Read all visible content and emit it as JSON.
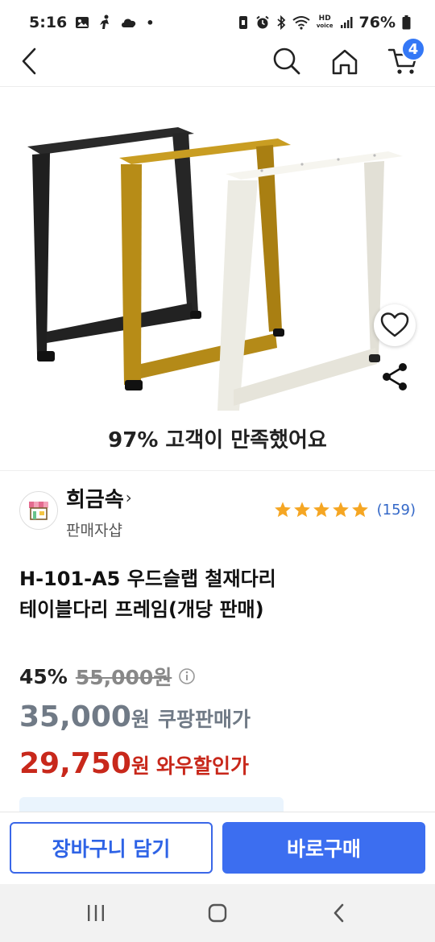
{
  "status_bar": {
    "time": "5:16",
    "dot": "•",
    "battery": "76%",
    "hd_label": "HD",
    "volte_label": "voice",
    "left_icons": [
      "gallery-icon",
      "figure-icon",
      "cloud-icon"
    ],
    "right_icons": [
      "vibrate-icon",
      "alarm-icon",
      "bluetooth-icon",
      "wifi-icon",
      "signal-icon",
      "battery-icon"
    ]
  },
  "header": {
    "icons": [
      "back-icon",
      "search-icon",
      "home-icon",
      "cart-icon"
    ],
    "cart_count": "4"
  },
  "product": {
    "satisfaction": "97% 고객이 만족했어요",
    "colors": {
      "black": "#252525",
      "gold": "#b8901b",
      "white": "#eeece4"
    },
    "image_icons": [
      "heart-icon",
      "share-icon"
    ]
  },
  "seller": {
    "name": "희금속",
    "type": "판매자샵",
    "rating": 5,
    "review_count": "(159)",
    "star_color": "#f5a623"
  },
  "title": {
    "line1": "H-101-A5 우드슬랩 철재다리",
    "line2": "테이블다리 프레임(개당 판매)"
  },
  "price": {
    "discount_rate": "45%",
    "original": "55,000원",
    "coupang_price": "35,000",
    "coupang_won": "원",
    "coupang_label": "쿠팡판매가",
    "wow_price": "29,750",
    "wow_won": "원",
    "wow_label": "와우할인가",
    "wow_color": "#c8281b"
  },
  "actions": {
    "add_to_cart": "장바구니 담기",
    "buy_now": "바로구매",
    "accent": "#3c6ef0"
  },
  "system_nav": {
    "icons": [
      "recents-icon",
      "home-button-icon",
      "back-nav-icon"
    ]
  }
}
